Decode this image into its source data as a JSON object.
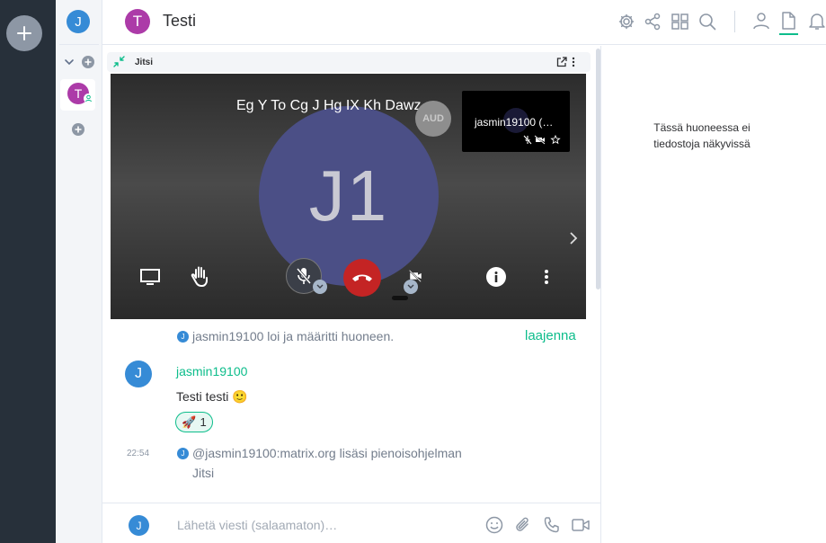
{
  "spaces": {
    "add_space_tooltip": ""
  },
  "user": {
    "avatar_initial": "J"
  },
  "room_list": {
    "rooms": [
      {
        "avatar_initial": "T"
      }
    ]
  },
  "header": {
    "room_avatar_initial": "T",
    "room_title": "Testi",
    "icons": [
      "settings-icon",
      "share-icon",
      "apps-icon",
      "search-icon",
      "people-icon",
      "files-icon",
      "notifications-icon"
    ]
  },
  "widget": {
    "title": "Jitsi",
    "participant_name": "Eg Y To Cg J Hg IX Kh Dawz…",
    "participant_initials": "J1",
    "audio_badge": "AUD",
    "thumbnail_name": "jasmin19100 (…"
  },
  "timeline": {
    "event_created": "jasmin19100 loi ja määritti huoneen.",
    "expand_label": "laajenna",
    "message": {
      "sender_initial": "J",
      "sender": "jasmin19100",
      "body": "Testi testi 🙂",
      "reaction_emoji": "🚀",
      "reaction_count": "1"
    },
    "widget_event": {
      "time": "22:54",
      "text": "@jasmin19100:matrix.org lisäsi pienoisohjelman",
      "widget_name": "Jitsi"
    }
  },
  "composer": {
    "avatar_initial": "J",
    "placeholder": "Lähetä viesti (salaamaton)…"
  },
  "right_panel": {
    "empty_text": "Tässä huoneessa ei tiedostoja näkyvissä"
  },
  "colors": {
    "accent": "#0dbd8b",
    "rail": "#27303a",
    "room_avatar": "#ac3ba8",
    "user_avatar": "#368bd6"
  }
}
